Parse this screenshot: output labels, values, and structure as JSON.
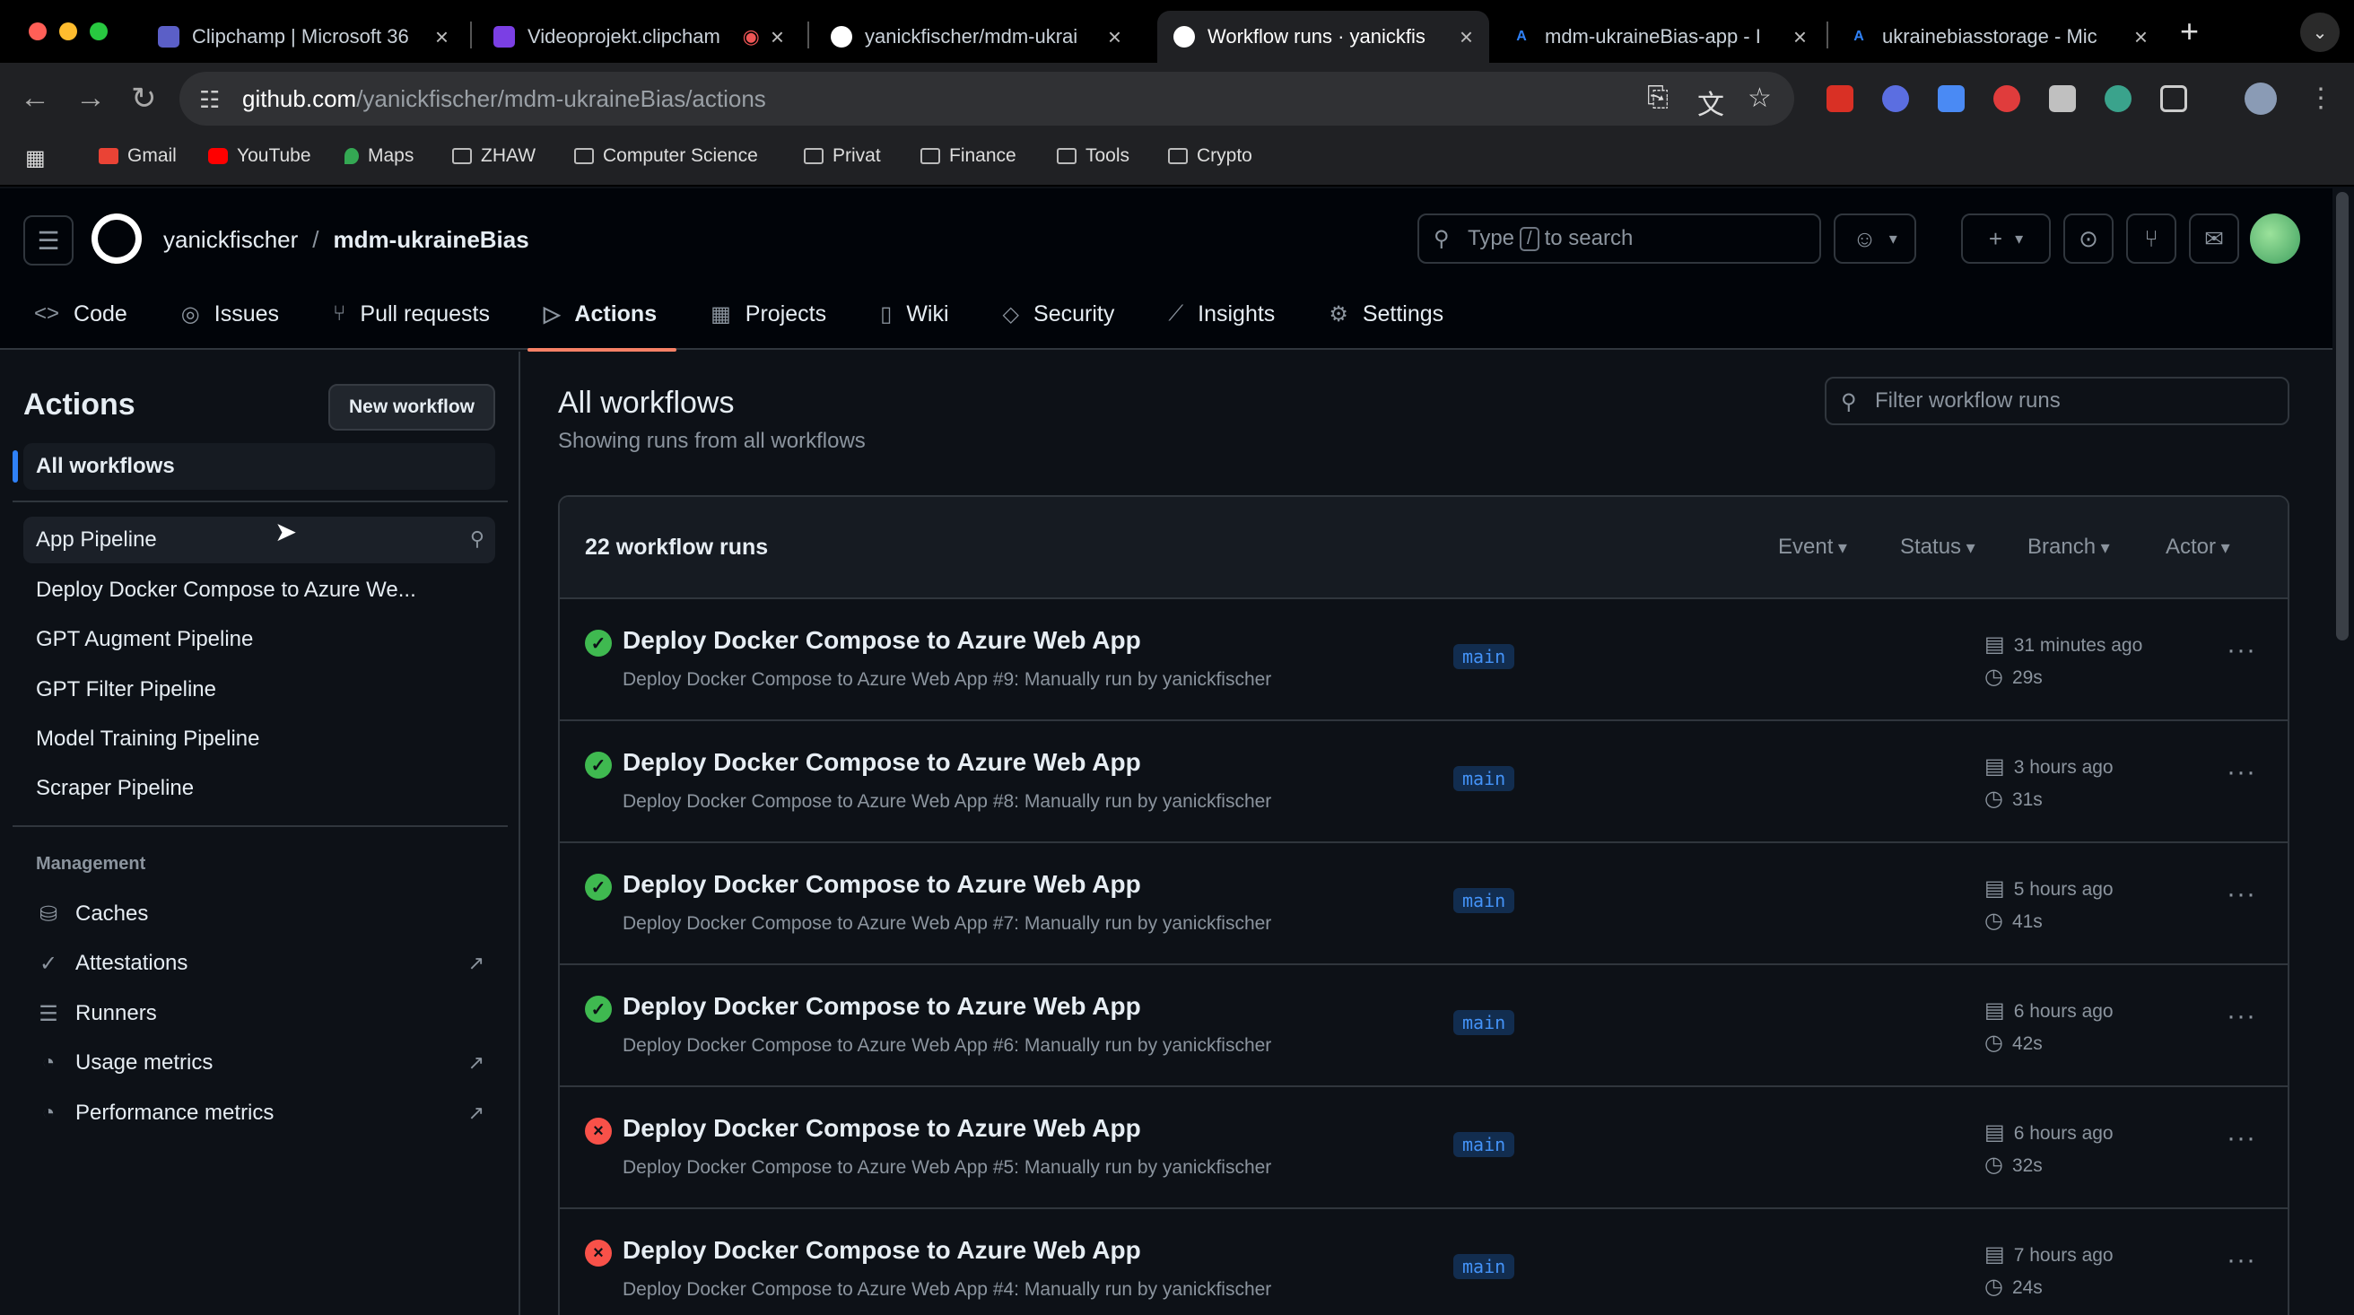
{
  "browser": {
    "tabs": [
      {
        "title": "Clipchamp | Microsoft 36",
        "color": "#5b5fc7"
      },
      {
        "title": "Videoprojekt.clipcham",
        "color": "#7b3fe4"
      },
      {
        "title": "yanickfischer/mdm-ukrai",
        "color": "#ffffff"
      },
      {
        "title": "Workflow runs · yanickfis",
        "color": "#ffffff"
      },
      {
        "title": "mdm-ukraineBias-app - I",
        "color": "#2f81f7"
      },
      {
        "title": "ukrainebiasstorage - Mic",
        "color": "#2f81f7"
      }
    ],
    "url_host": "github.com",
    "url_path": "/yanickfischer/mdm-ukraineBias/actions",
    "bookmarks": [
      "Gmail",
      "YouTube",
      "Maps",
      "ZHAW",
      "Computer Science",
      "Privat",
      "Finance",
      "Tools",
      "Crypto"
    ]
  },
  "header": {
    "owner": "yanickfischer",
    "separator": "/",
    "repo": "mdm-ukraineBias",
    "search_prefix": "Type",
    "search_key": "/",
    "search_suffix": "to search"
  },
  "repo_nav": [
    {
      "label": "Code",
      "icon": "<>"
    },
    {
      "label": "Issues",
      "icon": "◎"
    },
    {
      "label": "Pull requests",
      "icon": "⑂"
    },
    {
      "label": "Actions",
      "icon": "▷"
    },
    {
      "label": "Projects",
      "icon": "▦"
    },
    {
      "label": "Wiki",
      "icon": "▯"
    },
    {
      "label": "Security",
      "icon": "◇"
    },
    {
      "label": "Insights",
      "icon": "⟋"
    },
    {
      "label": "Settings",
      "icon": "⚙"
    }
  ],
  "sidebar": {
    "title": "Actions",
    "new_workflow": "New workflow",
    "all_workflows": "All workflows",
    "workflows": [
      "App Pipeline",
      "Deploy Docker Compose to Azure We...",
      "GPT Augment Pipeline",
      "GPT Filter Pipeline",
      "Model Training Pipeline",
      "Scraper Pipeline"
    ],
    "management_heading": "Management",
    "management": [
      {
        "label": "Caches",
        "icon": "database-icon"
      },
      {
        "label": "Attestations",
        "icon": "verified-icon"
      },
      {
        "label": "Runners",
        "icon": "server-icon"
      },
      {
        "label": "Usage metrics",
        "icon": "graph-icon"
      },
      {
        "label": "Performance metrics",
        "icon": "graph-icon"
      }
    ]
  },
  "main": {
    "title": "All workflows",
    "subtitle": "Showing runs from all workflows",
    "filter_placeholder": "Filter workflow runs",
    "count": "22 workflow runs",
    "filters": [
      "Event",
      "Status",
      "Branch",
      "Actor"
    ],
    "runs": [
      {
        "title": "Deploy Docker Compose to Azure Web App",
        "sub": "Deploy Docker Compose to Azure Web App #9: Manually run by yanickfischer",
        "branch": "main",
        "when": "31 minutes ago",
        "duration": "29s",
        "status": "success"
      },
      {
        "title": "Deploy Docker Compose to Azure Web App",
        "sub": "Deploy Docker Compose to Azure Web App #8: Manually run by yanickfischer",
        "branch": "main",
        "when": "3 hours ago",
        "duration": "31s",
        "status": "success"
      },
      {
        "title": "Deploy Docker Compose to Azure Web App",
        "sub": "Deploy Docker Compose to Azure Web App #7: Manually run by yanickfischer",
        "branch": "main",
        "when": "5 hours ago",
        "duration": "41s",
        "status": "success"
      },
      {
        "title": "Deploy Docker Compose to Azure Web App",
        "sub": "Deploy Docker Compose to Azure Web App #6: Manually run by yanickfischer",
        "branch": "main",
        "when": "6 hours ago",
        "duration": "42s",
        "status": "success"
      },
      {
        "title": "Deploy Docker Compose to Azure Web App",
        "sub": "Deploy Docker Compose to Azure Web App #5: Manually run by yanickfischer",
        "branch": "main",
        "when": "6 hours ago",
        "duration": "32s",
        "status": "failure"
      },
      {
        "title": "Deploy Docker Compose to Azure Web App",
        "sub": "Deploy Docker Compose to Azure Web App #4: Manually run by yanickfischer",
        "branch": "main",
        "when": "7 hours ago",
        "duration": "24s",
        "status": "failure"
      }
    ]
  }
}
